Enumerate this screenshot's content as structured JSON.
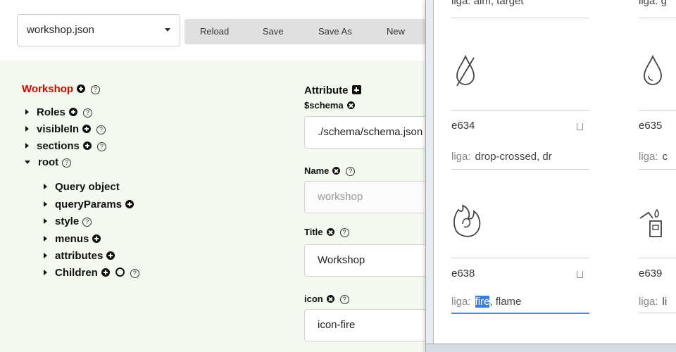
{
  "header": {
    "file_select": "workshop.json",
    "buttons": {
      "reload": "Reload",
      "save": "Save",
      "save_as": "Save As",
      "new": "New"
    }
  },
  "tree": {
    "root_label": "Workshop",
    "top_items": [
      "Roles",
      "visibleIn",
      "sections",
      "root"
    ],
    "root_children": [
      "Query object",
      "queryParams",
      "style",
      "menus",
      "attributes",
      "Children"
    ]
  },
  "attributes": {
    "heading": "Attribute",
    "schema_label": "$schema",
    "schema_value": "./schema/schema.json",
    "name_label": "Name",
    "name_value": "workshop",
    "title_label": "Title",
    "title_value": "Workshop",
    "icon_label": "icon",
    "icon_value": "icon-fire"
  },
  "icon_browser": {
    "top_partial": {
      "left_liga": "liga:  aim, target",
      "right_liga": "liga:  g"
    },
    "cards": [
      {
        "code": "e634",
        "liga_prefix": "liga:",
        "liga": "drop-crossed, dr",
        "icon": "drop-crossed-icon"
      },
      {
        "code": "e635",
        "liga_prefix": "liga:",
        "liga": "c",
        "icon": "drop-icon"
      },
      {
        "code": "e638",
        "liga_prefix": "liga:",
        "liga_selected": "fire",
        "liga": ", flame",
        "icon": "fire-icon"
      },
      {
        "code": "e639",
        "liga_prefix": "liga:",
        "liga": "li",
        "icon": "lighter-icon"
      }
    ]
  },
  "colors": {
    "accent": "#e00000",
    "selection": "#3b7ddd",
    "focus_line": "#4a90e2",
    "panel_bg": "#f4faef"
  }
}
